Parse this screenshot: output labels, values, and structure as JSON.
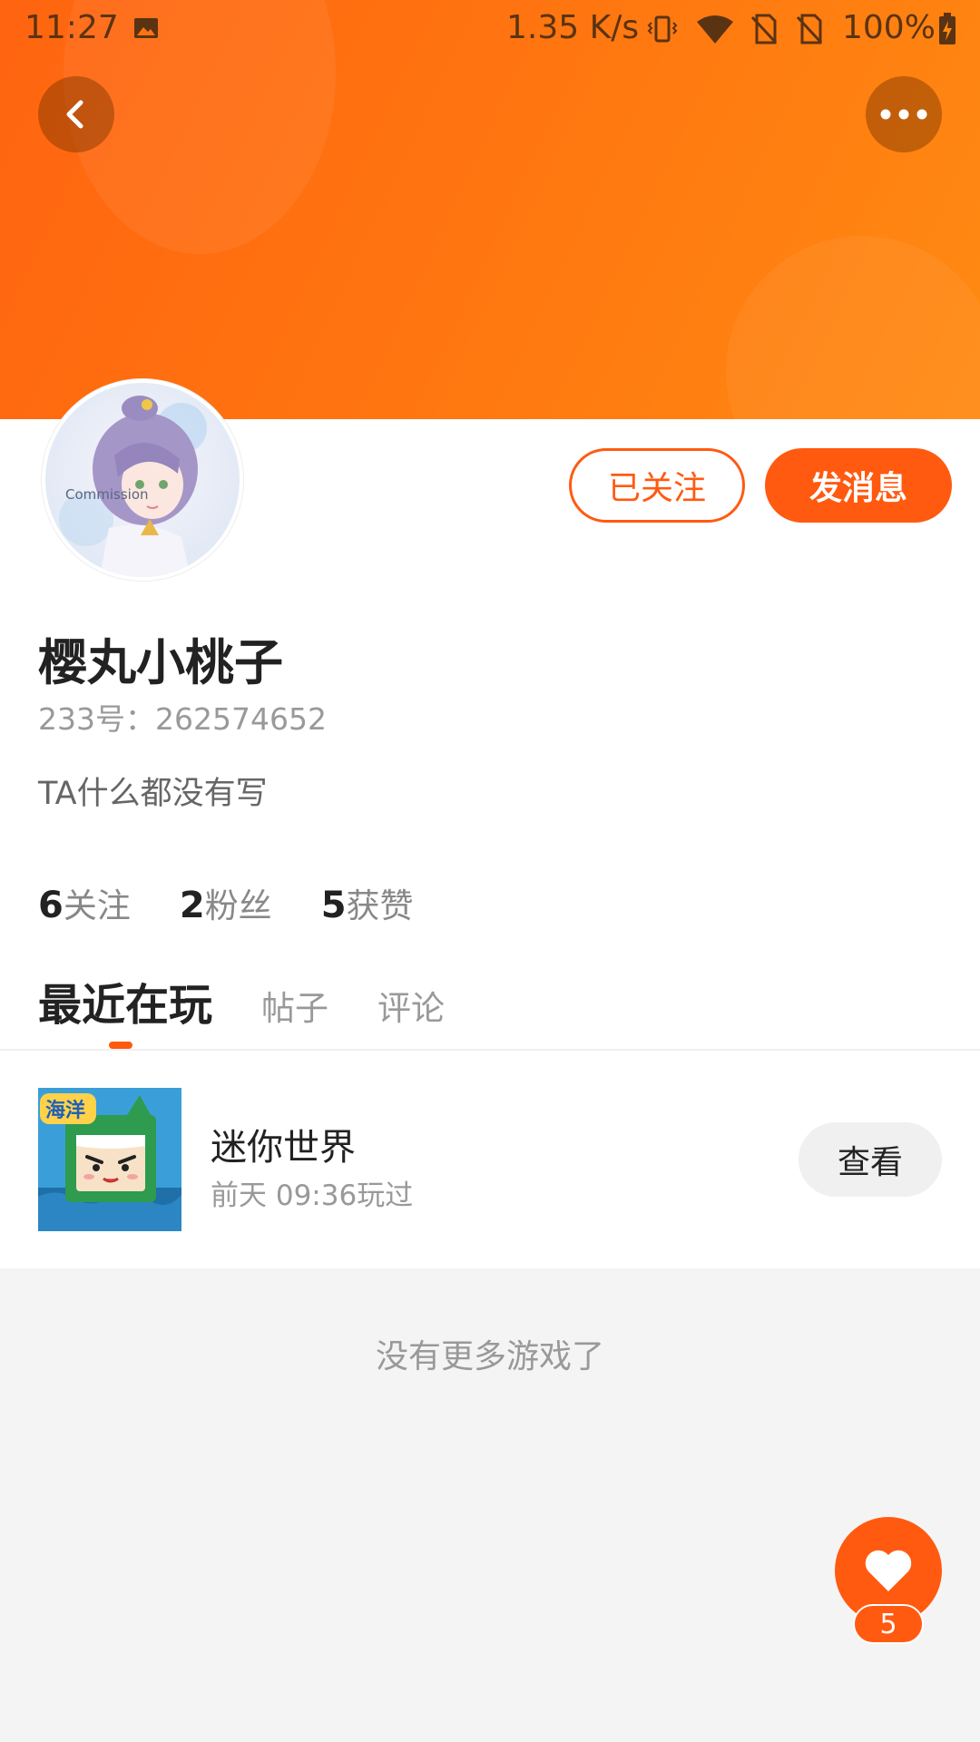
{
  "status_bar": {
    "time": "11:27",
    "network_speed": "1.35 K/s",
    "battery": "100%",
    "icons": [
      "image-icon",
      "vibrate-icon",
      "wifi-icon",
      "sim-off-icon",
      "sim-off-icon",
      "battery-charging-icon"
    ]
  },
  "nav": {
    "back_icon": "chevron-left-icon",
    "more_icon": "more-dots-icon"
  },
  "profile": {
    "name": "樱丸小桃子",
    "id_text": "233号：262574652",
    "bio": "TA什么都没有写",
    "follow_label": "已关注",
    "message_label": "发消息",
    "avatar_text": "Commission",
    "stats": [
      {
        "value": "6",
        "label": "关注"
      },
      {
        "value": "2",
        "label": "粉丝"
      },
      {
        "value": "5",
        "label": "获赞"
      }
    ]
  },
  "tabs": [
    {
      "label": "最近在玩",
      "active": true
    },
    {
      "label": "帖子",
      "active": false
    },
    {
      "label": "评论",
      "active": false
    }
  ],
  "games": [
    {
      "name": "迷你世界",
      "last_played": "前天 09:36玩过",
      "button_label": "查看",
      "thumb_badge": "海洋"
    }
  ],
  "list_end": "没有更多游戏了",
  "like": {
    "icon": "heart-icon",
    "count": "5"
  },
  "colors": {
    "accent": "#ff5a10",
    "banner_start": "#ff6410",
    "banner_end": "#ff8a12"
  }
}
